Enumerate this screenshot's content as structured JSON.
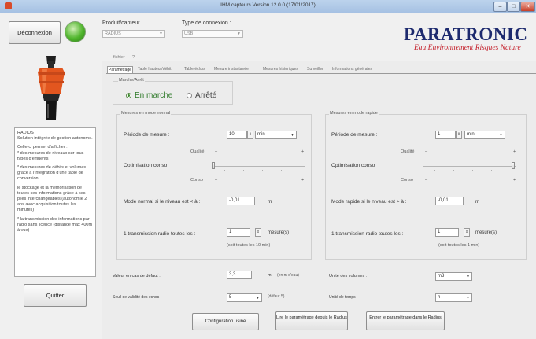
{
  "window": {
    "title": "IHM capteurs Version 12.0.0 (17/01/2017)",
    "minimize": "–",
    "maximize": "□",
    "close": "✕"
  },
  "top": {
    "disconnect_label": "Déconnexion",
    "product_label": "Produit/capteur :",
    "product_value": "RADIUS",
    "connection_label": "Type de connexion :",
    "connection_value": "USB"
  },
  "logo": {
    "name": "PARATRONIC",
    "tagline": "Eau Environnement Risques Nature"
  },
  "left": {
    "description": [
      "RADIUS\nSolution intégrée de gestion autonome.",
      "Celle-ci permet d'afficher :\n* des mesures de niveaux sur tous types d'effluents",
      "* des mesures de débits et volumes grâce à l'intégration d'une table de conversion",
      "le stockage et la mémorisation de toutes ces informations grâce à ses piles interchangeables (autonomie 2 ans avec acquisition toutes les minutes)",
      "* la transmission des informations par radio sans licence (distance max 400m à vue)"
    ],
    "quit_label": "Quitter"
  },
  "menu": {
    "file": "fichier",
    "help": "?"
  },
  "tabs": [
    "Paramétrage",
    "Table hauteur/débit",
    "Table échos",
    "Mesure instantanée",
    "Mesures historiques",
    "Surveiller",
    "Informations générales"
  ],
  "onoff": {
    "title": "Marche/Arrêt",
    "on_label": "En marche",
    "off_label": "Arrêté",
    "selected": "on"
  },
  "normal": {
    "title": "Mesures en mode normal",
    "period_label": "Période de mesure :",
    "period_value": "10",
    "period_unit": "min",
    "quality_label": "Qualité",
    "minus": "–",
    "plus": "+",
    "optimization_label": "Optimisation conso",
    "conso_label": "Conso",
    "slider_value": 0,
    "mode_label": "Mode normal si le niveau est < à :",
    "mode_value": "-0,01",
    "mode_unit": "m",
    "radio_label": "1 transmission radio toutes les :",
    "radio_value": "1",
    "radio_unit": "mesure(s)",
    "radio_note": "(soit toutes les 10 min)"
  },
  "fast": {
    "title": "Mesures en mode rapide",
    "period_label": "Période de mesure :",
    "period_value": "1",
    "period_unit": "min",
    "quality_label": "Qualité",
    "minus": "–",
    "plus": "+",
    "optimization_label": "Optimisation conso",
    "conso_label": "Conso",
    "slider_value": 1,
    "mode_label": "Mode rapide si le niveau est > à :",
    "mode_value": "-0,01",
    "mode_unit": "m",
    "radio_label": "1 transmission radio toutes les :",
    "radio_value": "1",
    "radio_unit": "mesure(s)",
    "radio_note": "(soit toutes les 1 min)"
  },
  "bottom": {
    "default_label": "Valeur en cas de défaut :",
    "default_value": "3,3",
    "default_unit": "m",
    "default_note": "(en m d'eau)",
    "volume_label": "Unité des volumes :",
    "volume_value": "m3",
    "threshold_label": "Seuil de validité des échos :",
    "threshold_value": "5",
    "threshold_note": "(défaut 5)",
    "time_label": "Unité de temps :",
    "time_value": "h"
  },
  "buttons": {
    "factory": "Configuration usine",
    "read": "Lire le paramétrage depuis le Radius",
    "write": "Entrer le paramétrage dans le Radius"
  }
}
